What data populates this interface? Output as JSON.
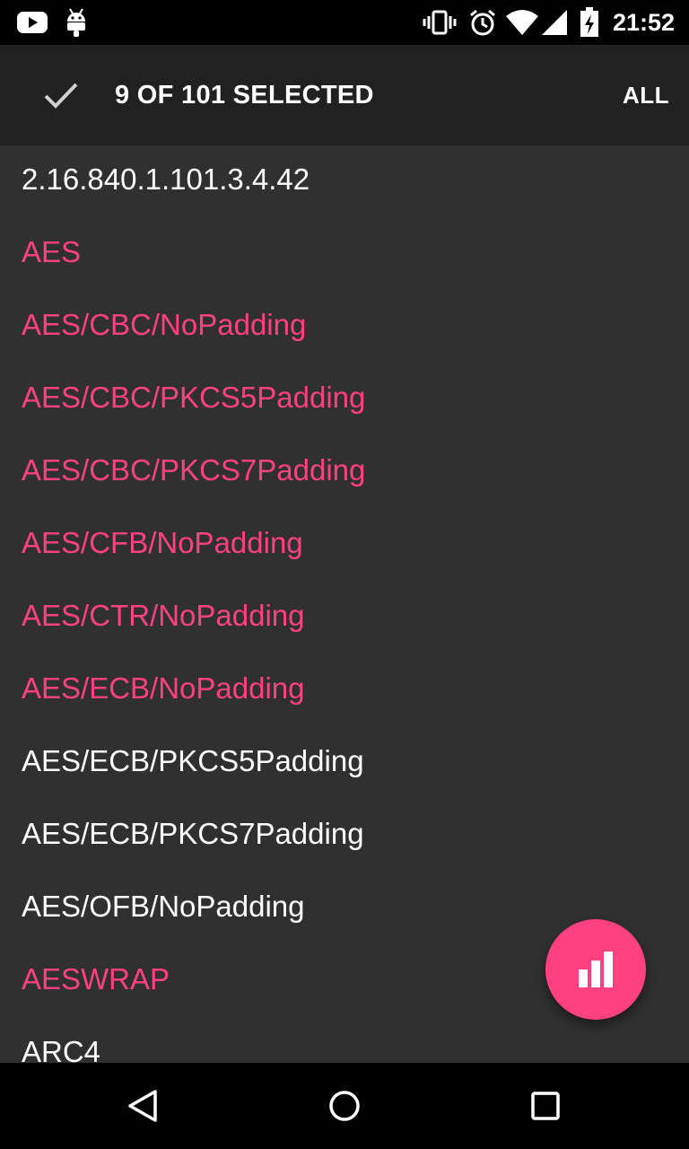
{
  "status_bar": {
    "time": "21:52",
    "icons": [
      "youtube-icon",
      "android-icon",
      "vibrate-icon",
      "alarm-icon",
      "wifi-icon",
      "cell-signal-icon",
      "battery-charging-icon"
    ]
  },
  "action_bar": {
    "title": "9 OF 101 SELECTED",
    "all_label": "ALL",
    "icon": "check-icon"
  },
  "list": {
    "items": [
      {
        "label": "2.16.840.1.101.3.4.42",
        "selected": false
      },
      {
        "label": "AES",
        "selected": true
      },
      {
        "label": "AES/CBC/NoPadding",
        "selected": true
      },
      {
        "label": "AES/CBC/PKCS5Padding",
        "selected": true
      },
      {
        "label": "AES/CBC/PKCS7Padding",
        "selected": true
      },
      {
        "label": "AES/CFB/NoPadding",
        "selected": true
      },
      {
        "label": "AES/CTR/NoPadding",
        "selected": true
      },
      {
        "label": "AES/ECB/NoPadding",
        "selected": true
      },
      {
        "label": "AES/ECB/PKCS5Padding",
        "selected": false
      },
      {
        "label": "AES/ECB/PKCS7Padding",
        "selected": false
      },
      {
        "label": "AES/OFB/NoPadding",
        "selected": false
      },
      {
        "label": "AESWRAP",
        "selected": true
      },
      {
        "label": "ARC4",
        "selected": false
      }
    ]
  },
  "fab": {
    "icon": "bar-chart-icon"
  },
  "nav_bar": {
    "icons": [
      "back-icon",
      "home-icon",
      "recents-icon"
    ]
  },
  "colors": {
    "accent": "#ff4081",
    "background": "#303030",
    "toolbar": "#212121",
    "text": "#ffffff"
  }
}
